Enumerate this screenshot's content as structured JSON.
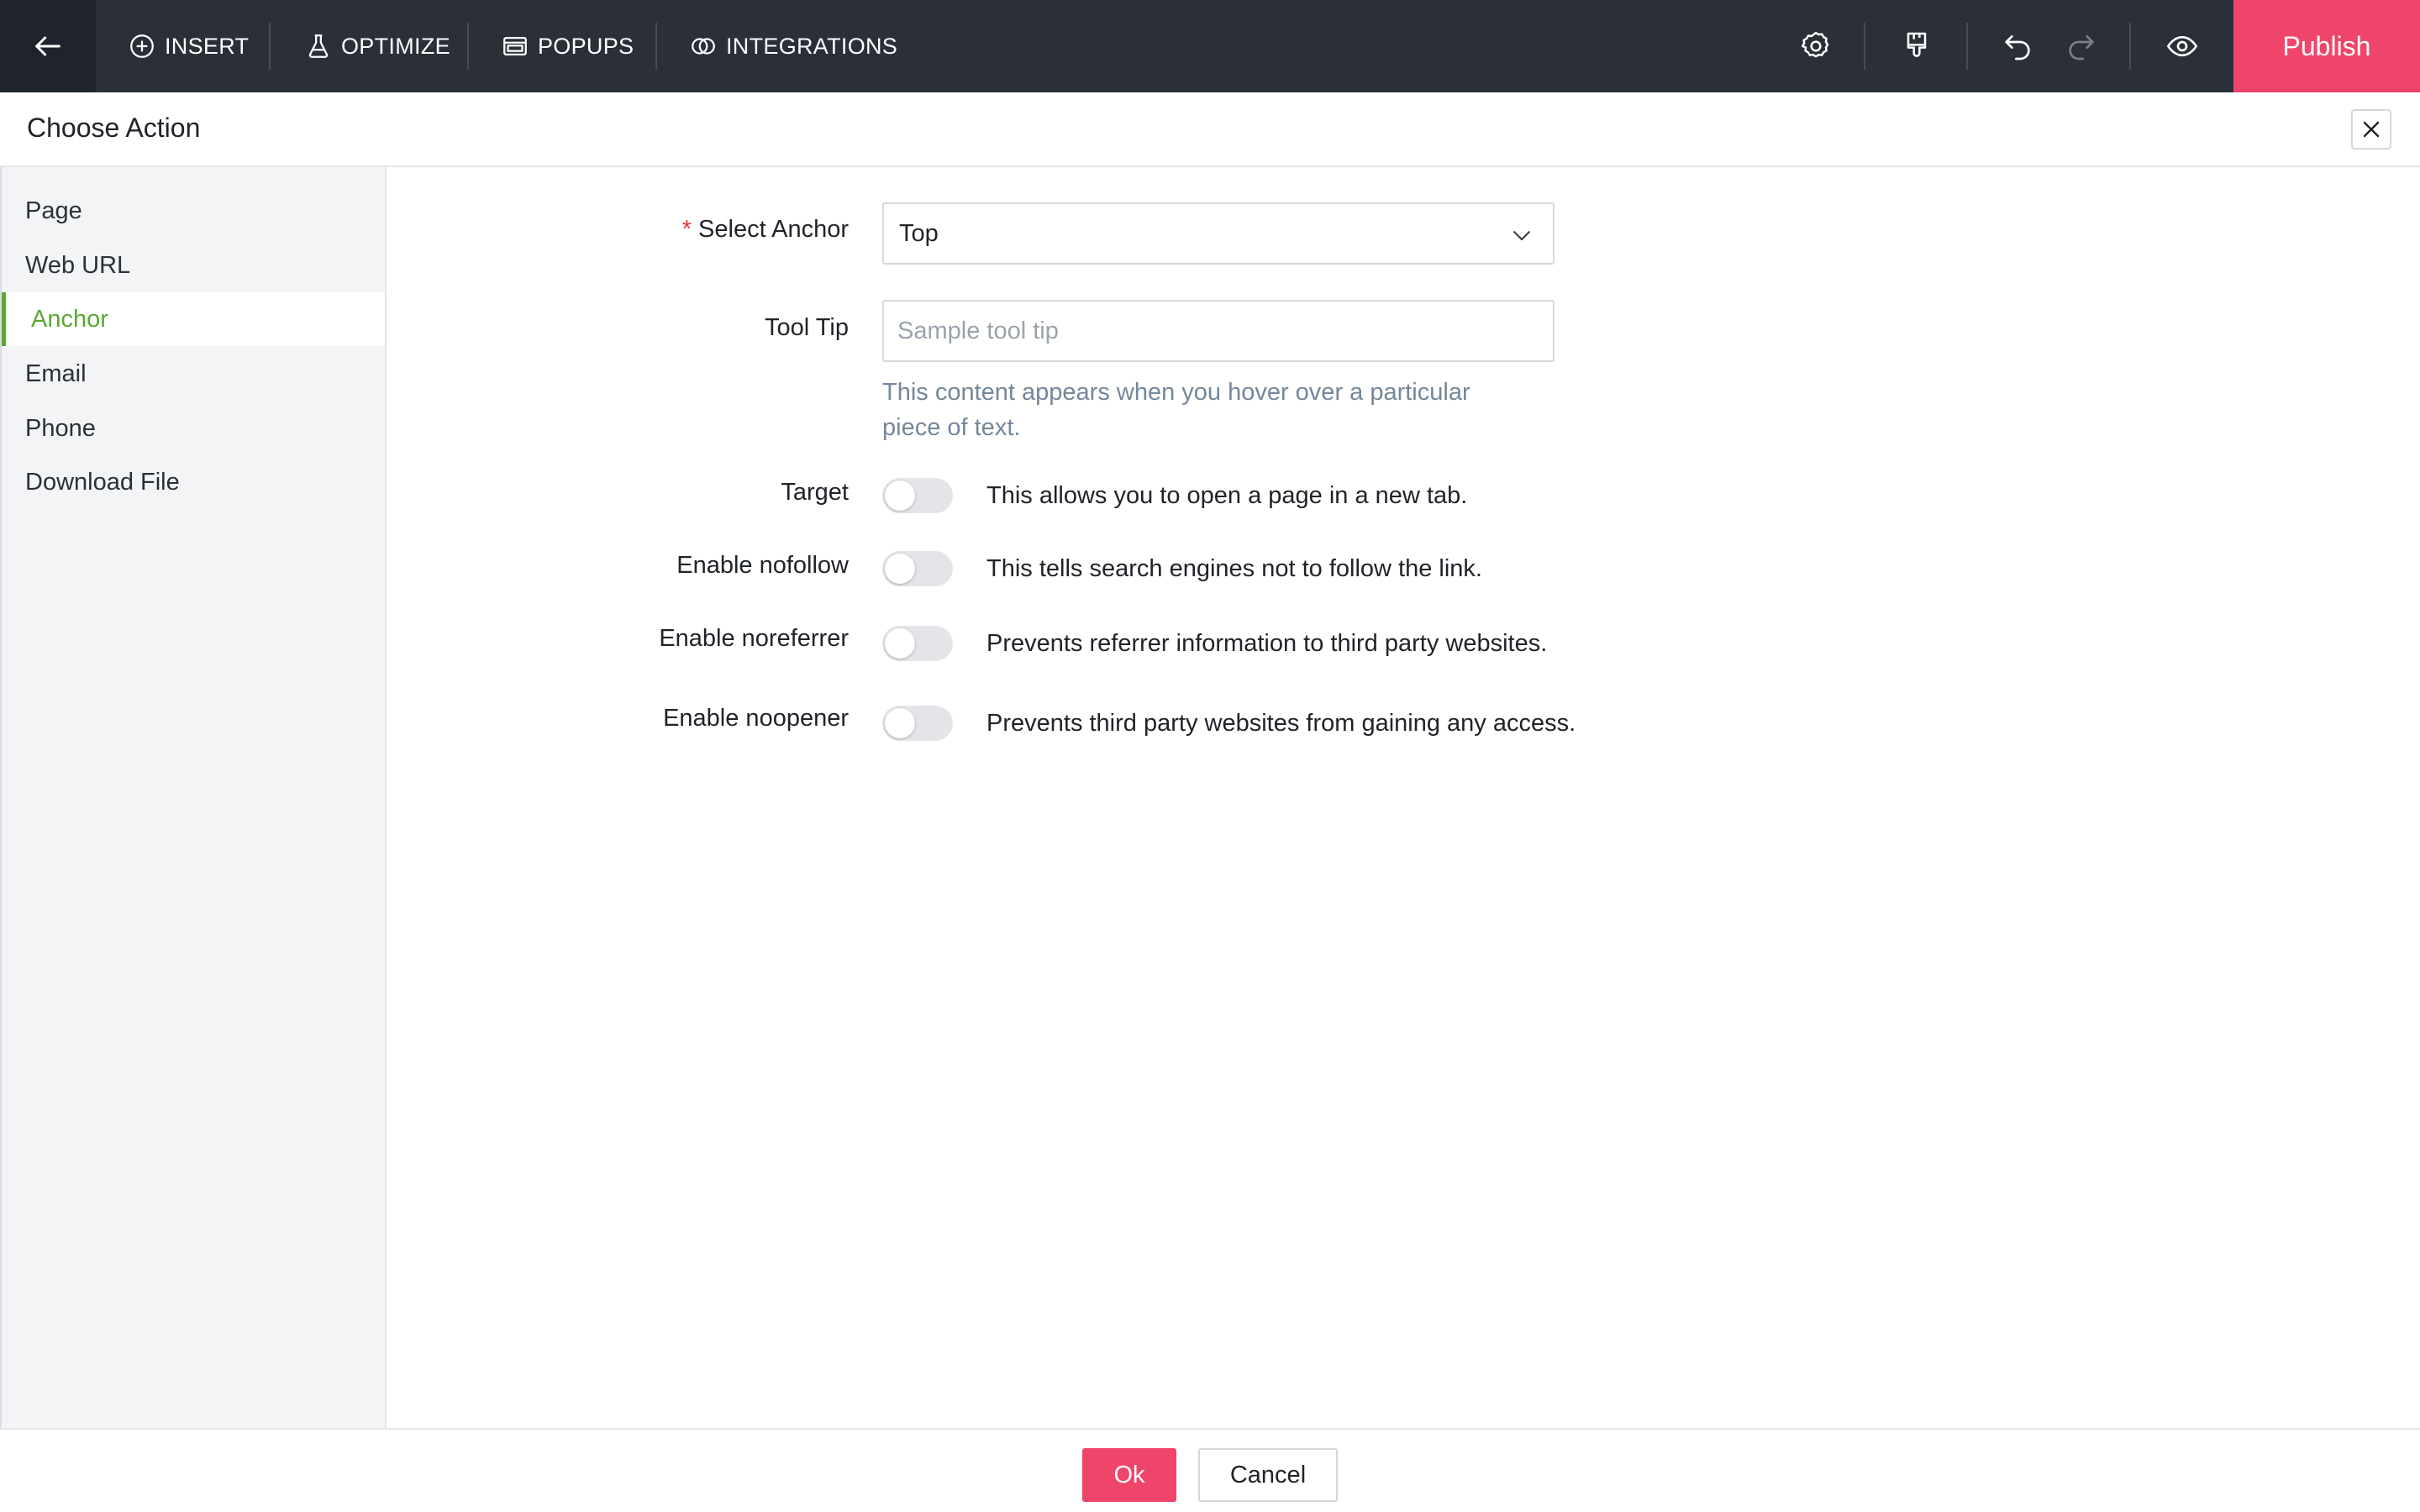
{
  "toolbar": {
    "back_icon": "arrow-left-icon",
    "insert": {
      "label": "INSERT",
      "icon": "plus-circle-icon"
    },
    "optimize": {
      "label": "OPTIMIZE",
      "icon": "flask-icon"
    },
    "popups": {
      "label": "POPUPS",
      "icon": "popup-window-icon"
    },
    "integrations": {
      "label": "INTEGRATIONS",
      "icon": "integrations-rings-icon"
    },
    "right_icons": [
      "gear-icon",
      "paint-brush-icon",
      "undo-icon",
      "redo-icon",
      "eye-icon"
    ],
    "publish_label": "Publish",
    "colors": {
      "bar": "#2b2f38",
      "publish": "#f0456b"
    }
  },
  "dialog": {
    "title": "Choose Action",
    "close_icon": "close-icon"
  },
  "sidebar": {
    "items": [
      {
        "label": "Page",
        "active": false
      },
      {
        "label": "Web URL",
        "active": false
      },
      {
        "label": "Anchor",
        "active": true
      },
      {
        "label": "Email",
        "active": false
      },
      {
        "label": "Phone",
        "active": false
      },
      {
        "label": "Download File",
        "active": false
      }
    ],
    "active_color": "#5aa832"
  },
  "form": {
    "select_anchor": {
      "required_mark": "*",
      "label": "Select Anchor",
      "value": "Top"
    },
    "tooltip": {
      "label": "Tool Tip",
      "placeholder": "Sample tool tip",
      "hint": "This content appears when you hover over a particular piece of text."
    },
    "toggles": [
      {
        "label": "Target",
        "description": "This allows you to open a page in a new tab.",
        "on": false
      },
      {
        "label": "Enable nofollow",
        "description": "This tells search engines not to follow the link.",
        "on": false
      },
      {
        "label": "Enable noreferrer",
        "description": "Prevents referrer information to third party websites.",
        "on": false
      },
      {
        "label": "Enable noopener",
        "description": "Prevents third party websites from gaining any access.",
        "on": false
      }
    ]
  },
  "footer": {
    "ok_label": "Ok",
    "cancel_label": "Cancel"
  }
}
